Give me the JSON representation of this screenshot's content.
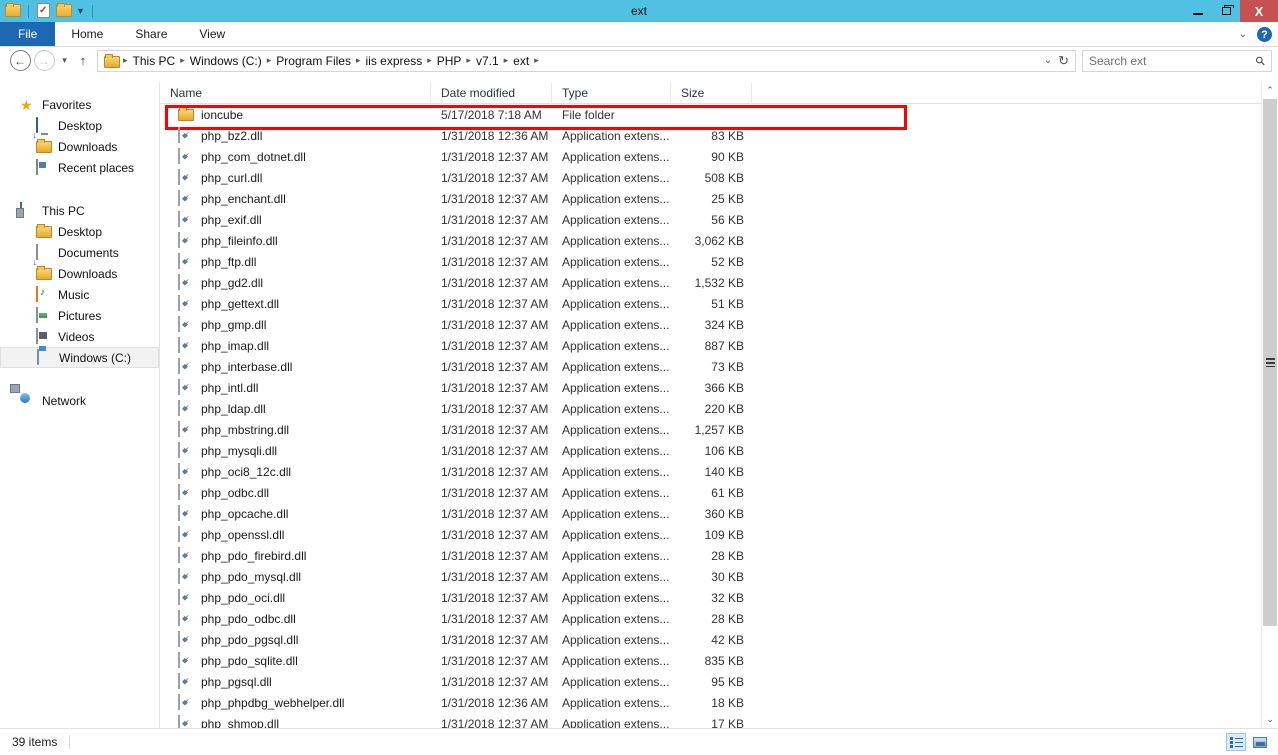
{
  "window": {
    "title": "ext",
    "quick_access": [
      "folder-icon",
      "new-folder-icon",
      "properties-icon",
      "customize-caret"
    ],
    "controls": {
      "minimize": "–",
      "maximize": "❐",
      "close": "X"
    }
  },
  "ribbon": {
    "tabs": [
      {
        "label": "File",
        "active": true
      },
      {
        "label": "Home",
        "active": false
      },
      {
        "label": "Share",
        "active": false
      },
      {
        "label": "View",
        "active": false
      }
    ],
    "collapse_caret": "⌄",
    "help_label": "?"
  },
  "address": {
    "back": "←",
    "forward": "→",
    "recent_caret": "▾",
    "up": "↑",
    "breadcrumbs": [
      "This PC",
      "Windows (C:)",
      "Program Files",
      "iis express",
      "PHP",
      "v7.1",
      "ext"
    ],
    "separator": "▸",
    "dropdown_caret": "⌄",
    "refresh": "↻"
  },
  "search": {
    "placeholder": "Search ext",
    "icon": "search-icon"
  },
  "sidebar": {
    "groups": [
      {
        "label": "Favorites",
        "icon": "star-icon",
        "items": [
          {
            "label": "Desktop",
            "icon": "desktop-icon"
          },
          {
            "label": "Downloads",
            "icon": "downloads-folder-icon"
          },
          {
            "label": "Recent places",
            "icon": "recent-places-icon"
          }
        ]
      },
      {
        "label": "This PC",
        "icon": "computer-icon",
        "items": [
          {
            "label": "Desktop",
            "icon": "desktop-folder-icon"
          },
          {
            "label": "Documents",
            "icon": "documents-icon"
          },
          {
            "label": "Downloads",
            "icon": "downloads-folder-icon"
          },
          {
            "label": "Music",
            "icon": "music-icon"
          },
          {
            "label": "Pictures",
            "icon": "pictures-icon"
          },
          {
            "label": "Videos",
            "icon": "videos-icon"
          },
          {
            "label": "Windows (C:)",
            "icon": "drive-icon",
            "selected": true
          }
        ]
      },
      {
        "label": "Network",
        "icon": "network-icon",
        "items": []
      }
    ]
  },
  "columns": [
    {
      "key": "name",
      "label": "Name",
      "sorted": "asc"
    },
    {
      "key": "date",
      "label": "Date modified"
    },
    {
      "key": "type",
      "label": "Type"
    },
    {
      "key": "size",
      "label": "Size"
    }
  ],
  "files": [
    {
      "name": "ioncube",
      "date": "5/17/2018 7:18 AM",
      "type": "File folder",
      "size": "",
      "icon": "folder-icon",
      "highlighted": true
    },
    {
      "name": "php_bz2.dll",
      "date": "1/31/2018 12:36 AM",
      "type": "Application extens...",
      "size": "83 KB",
      "icon": "dll-icon"
    },
    {
      "name": "php_com_dotnet.dll",
      "date": "1/31/2018 12:37 AM",
      "type": "Application extens...",
      "size": "90 KB",
      "icon": "dll-icon"
    },
    {
      "name": "php_curl.dll",
      "date": "1/31/2018 12:37 AM",
      "type": "Application extens...",
      "size": "508 KB",
      "icon": "dll-icon"
    },
    {
      "name": "php_enchant.dll",
      "date": "1/31/2018 12:37 AM",
      "type": "Application extens...",
      "size": "25 KB",
      "icon": "dll-icon"
    },
    {
      "name": "php_exif.dll",
      "date": "1/31/2018 12:37 AM",
      "type": "Application extens...",
      "size": "56 KB",
      "icon": "dll-icon"
    },
    {
      "name": "php_fileinfo.dll",
      "date": "1/31/2018 12:37 AM",
      "type": "Application extens...",
      "size": "3,062 KB",
      "icon": "dll-icon"
    },
    {
      "name": "php_ftp.dll",
      "date": "1/31/2018 12:37 AM",
      "type": "Application extens...",
      "size": "52 KB",
      "icon": "dll-icon"
    },
    {
      "name": "php_gd2.dll",
      "date": "1/31/2018 12:37 AM",
      "type": "Application extens...",
      "size": "1,532 KB",
      "icon": "dll-icon"
    },
    {
      "name": "php_gettext.dll",
      "date": "1/31/2018 12:37 AM",
      "type": "Application extens...",
      "size": "51 KB",
      "icon": "dll-icon"
    },
    {
      "name": "php_gmp.dll",
      "date": "1/31/2018 12:37 AM",
      "type": "Application extens...",
      "size": "324 KB",
      "icon": "dll-icon"
    },
    {
      "name": "php_imap.dll",
      "date": "1/31/2018 12:37 AM",
      "type": "Application extens...",
      "size": "887 KB",
      "icon": "dll-icon"
    },
    {
      "name": "php_interbase.dll",
      "date": "1/31/2018 12:37 AM",
      "type": "Application extens...",
      "size": "73 KB",
      "icon": "dll-icon"
    },
    {
      "name": "php_intl.dll",
      "date": "1/31/2018 12:37 AM",
      "type": "Application extens...",
      "size": "366 KB",
      "icon": "dll-icon"
    },
    {
      "name": "php_ldap.dll",
      "date": "1/31/2018 12:37 AM",
      "type": "Application extens...",
      "size": "220 KB",
      "icon": "dll-icon"
    },
    {
      "name": "php_mbstring.dll",
      "date": "1/31/2018 12:37 AM",
      "type": "Application extens...",
      "size": "1,257 KB",
      "icon": "dll-icon"
    },
    {
      "name": "php_mysqli.dll",
      "date": "1/31/2018 12:37 AM",
      "type": "Application extens...",
      "size": "106 KB",
      "icon": "dll-icon"
    },
    {
      "name": "php_oci8_12c.dll",
      "date": "1/31/2018 12:37 AM",
      "type": "Application extens...",
      "size": "140 KB",
      "icon": "dll-icon"
    },
    {
      "name": "php_odbc.dll",
      "date": "1/31/2018 12:37 AM",
      "type": "Application extens...",
      "size": "61 KB",
      "icon": "dll-icon"
    },
    {
      "name": "php_opcache.dll",
      "date": "1/31/2018 12:37 AM",
      "type": "Application extens...",
      "size": "360 KB",
      "icon": "dll-icon"
    },
    {
      "name": "php_openssl.dll",
      "date": "1/31/2018 12:37 AM",
      "type": "Application extens...",
      "size": "109 KB",
      "icon": "dll-icon"
    },
    {
      "name": "php_pdo_firebird.dll",
      "date": "1/31/2018 12:37 AM",
      "type": "Application extens...",
      "size": "28 KB",
      "icon": "dll-icon"
    },
    {
      "name": "php_pdo_mysql.dll",
      "date": "1/31/2018 12:37 AM",
      "type": "Application extens...",
      "size": "30 KB",
      "icon": "dll-icon"
    },
    {
      "name": "php_pdo_oci.dll",
      "date": "1/31/2018 12:37 AM",
      "type": "Application extens...",
      "size": "32 KB",
      "icon": "dll-icon"
    },
    {
      "name": "php_pdo_odbc.dll",
      "date": "1/31/2018 12:37 AM",
      "type": "Application extens...",
      "size": "28 KB",
      "icon": "dll-icon"
    },
    {
      "name": "php_pdo_pgsql.dll",
      "date": "1/31/2018 12:37 AM",
      "type": "Application extens...",
      "size": "42 KB",
      "icon": "dll-icon"
    },
    {
      "name": "php_pdo_sqlite.dll",
      "date": "1/31/2018 12:37 AM",
      "type": "Application extens...",
      "size": "835 KB",
      "icon": "dll-icon"
    },
    {
      "name": "php_pgsql.dll",
      "date": "1/31/2018 12:37 AM",
      "type": "Application extens...",
      "size": "95 KB",
      "icon": "dll-icon"
    },
    {
      "name": "php_phpdbg_webhelper.dll",
      "date": "1/31/2018 12:36 AM",
      "type": "Application extens...",
      "size": "18 KB",
      "icon": "dll-icon"
    },
    {
      "name": "php_shmop.dll",
      "date": "1/31/2018 12:37 AM",
      "type": "Application extens...",
      "size": "17 KB",
      "icon": "dll-icon"
    }
  ],
  "scrollbar": {
    "up_arrow": "⌃",
    "down_arrow": "⌄",
    "grip": "grip-icon"
  },
  "statusbar": {
    "item_count": "39 items",
    "views": [
      {
        "name": "details-view-button",
        "active": true
      },
      {
        "name": "large-icons-view-button",
        "active": false
      }
    ]
  },
  "colors": {
    "titlebar": "#50c0e3",
    "file_tab": "#1c68b3",
    "close_button": "#c75050",
    "highlight_box": "#ff0000",
    "selection": "#f2f2f2"
  }
}
